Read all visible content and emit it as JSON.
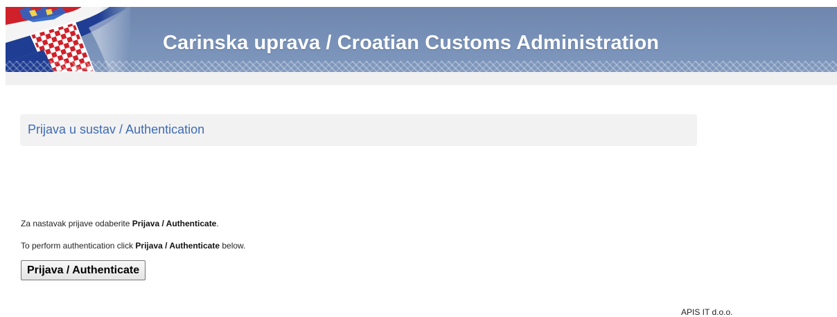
{
  "header": {
    "title": "Carinska uprava / Croatian Customs Administration",
    "flag_icon": "croatian-flag-icon",
    "colors": {
      "banner": "#7891b8",
      "flag_red": "#d0202a",
      "flag_blue": "#1f3e93"
    }
  },
  "section": {
    "title": "Prijava u sustav / Authentication",
    "title_color": "#3e6bb4"
  },
  "instructions": {
    "line1_prefix": "Za nastavak prijave odaberite ",
    "line1_bold": "Prijava / Authenticate",
    "line1_suffix": ".",
    "line2_prefix": "To perform authentication click ",
    "line2_bold": "Prijava / Authenticate",
    "line2_suffix": " below."
  },
  "auth_button": {
    "label": "Prijava / Authenticate"
  },
  "footer": {
    "company": "APIS IT d.o.o."
  }
}
